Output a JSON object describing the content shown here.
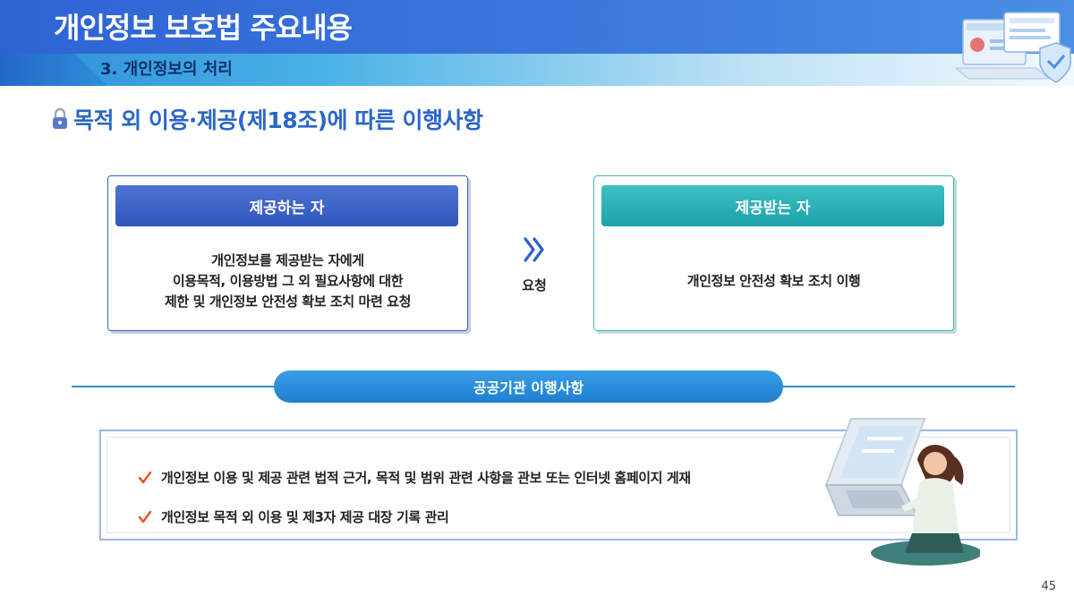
{
  "header": {
    "title": "개인정보 보호법 주요내용",
    "subtitle": "3. 개인정보의 처리"
  },
  "section": {
    "heading": "목적 외 이용·제공(제18조)에 따른 이행사항",
    "icon": "lock-icon"
  },
  "provider": {
    "title": "제공하는 자",
    "lines": [
      "개인정보를 제공받는 자에게",
      "이용목적, 이용방법 그 외 필요사항에 대한",
      "제한 및 개인정보 안전성 확보 조치 마련 요청"
    ]
  },
  "flow": {
    "icon": "double-chevron-right-icon",
    "label": "요청"
  },
  "receiver": {
    "title": "제공받는 자",
    "lines": [
      "개인정보 안전성 확보 조치 이행"
    ]
  },
  "public_agency": {
    "title": "공공기관 이행사항",
    "items": [
      "개인정보 이용 및 제공 관련 법적 근거, 목적 및 범위 관련 사항을 관보 또는 인터넷 홈페이지 게재",
      "개인정보 목적 외 이용 및 제3자 제공 대장 기록 관리"
    ],
    "item_icon": "check-icon"
  },
  "page_number": "45",
  "colors": {
    "header_blue": "#2f63d4",
    "heading_blue": "#2a66c9",
    "provider_blue": "#2f56bb",
    "receiver_teal": "#1aa2ab",
    "pill_blue": "#1f7fd0",
    "check_orange": "#e8501e"
  }
}
